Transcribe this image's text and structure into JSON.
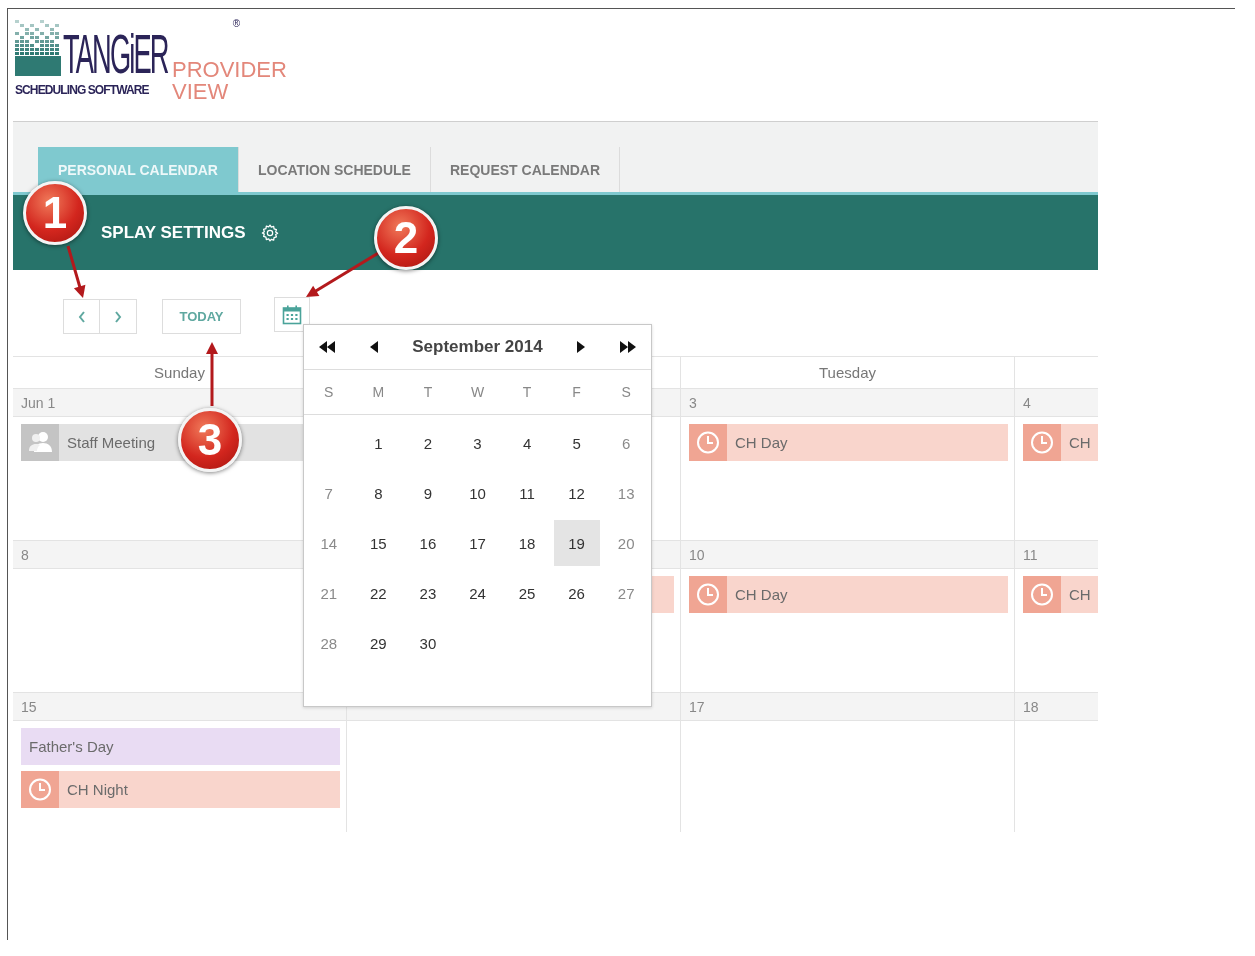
{
  "logo": {
    "brand": "TANGiER",
    "registered": "®",
    "tagline": "SCHEDULING SOFTWARE",
    "product": [
      "PROVIDER",
      "VIEW"
    ]
  },
  "tabs": [
    {
      "label": "PERSONAL CALENDAR",
      "selected": true
    },
    {
      "label": "LOCATION SCHEDULE",
      "selected": false
    },
    {
      "label": "REQUEST CALENDAR",
      "selected": false
    }
  ],
  "settings_bar": {
    "label": "SPLAY SETTINGS"
  },
  "toolbar": {
    "today": "TODAY"
  },
  "calendar": {
    "headers": [
      {
        "kind": "label",
        "label": "Sunday"
      },
      {
        "kind": "blank"
      },
      {
        "kind": "label",
        "label": "Tuesday"
      },
      {
        "kind": "blank"
      }
    ],
    "weeks": [
      {
        "days": [
          {
            "kind": "day",
            "date": "Jun 1",
            "events": [
              {
                "kind": "meeting",
                "title": "Staff Meeting"
              }
            ]
          },
          {
            "kind": "covered"
          },
          {
            "kind": "day",
            "date": "3",
            "events": [
              {
                "kind": "shift",
                "title": "CH Day"
              }
            ]
          },
          {
            "kind": "day",
            "date": "4",
            "events": [
              {
                "kind": "shift",
                "title": "CH"
              }
            ]
          }
        ]
      },
      {
        "days": [
          {
            "kind": "day",
            "date": "8"
          },
          {
            "kind": "covered",
            "events": [
              {
                "kind": "shift"
              }
            ]
          },
          {
            "kind": "day",
            "date": "10",
            "events": [
              {
                "kind": "shift",
                "title": "CH Day"
              }
            ]
          },
          {
            "kind": "day",
            "date": "11",
            "events": [
              {
                "kind": "shift",
                "title": "CH"
              }
            ]
          }
        ]
      },
      {
        "days": [
          {
            "kind": "day",
            "date": "15",
            "events": [
              {
                "kind": "holiday",
                "title": "Father's Day"
              },
              {
                "kind": "shift",
                "title": "CH Night"
              }
            ]
          },
          {
            "kind": "covered"
          },
          {
            "kind": "day",
            "date": "17"
          },
          {
            "kind": "day",
            "date": "18"
          }
        ]
      }
    ]
  },
  "date_picker": {
    "title": "September 2014",
    "weekdays": [
      "S",
      "M",
      "T",
      "W",
      "T",
      "F",
      "S"
    ],
    "rows": [
      {
        "days": [
          {
            "label": "1",
            "weekend": false,
            "selected": false
          },
          {
            "label": "2",
            "weekend": false,
            "selected": false
          },
          {
            "label": "3",
            "weekend": false,
            "selected": false
          },
          {
            "label": "4",
            "weekend": false,
            "selected": false
          },
          {
            "label": "5",
            "weekend": false,
            "selected": false
          },
          {
            "label": "6",
            "weekend": true,
            "selected": false
          }
        ]
      },
      {
        "days": [
          {
            "label": "7",
            "weekend": true,
            "selected": false
          },
          {
            "label": "8",
            "weekend": false,
            "selected": false
          },
          {
            "label": "9",
            "weekend": false,
            "selected": false
          },
          {
            "label": "10",
            "weekend": false,
            "selected": false
          },
          {
            "label": "11",
            "weekend": false,
            "selected": false
          },
          {
            "label": "12",
            "weekend": false,
            "selected": false
          },
          {
            "label": "13",
            "weekend": true,
            "selected": false
          }
        ]
      },
      {
        "days": [
          {
            "label": "14",
            "weekend": true,
            "selected": false
          },
          {
            "label": "15",
            "weekend": false,
            "selected": false
          },
          {
            "label": "16",
            "weekend": false,
            "selected": false
          },
          {
            "label": "17",
            "weekend": false,
            "selected": false
          },
          {
            "label": "18",
            "weekend": false,
            "selected": false
          },
          {
            "label": "19",
            "weekend": false,
            "selected": true
          },
          {
            "label": "20",
            "weekend": true,
            "selected": false
          }
        ]
      },
      {
        "days": [
          {
            "label": "21",
            "weekend": true,
            "selected": false
          },
          {
            "label": "22",
            "weekend": false,
            "selected": false
          },
          {
            "label": "23",
            "weekend": false,
            "selected": false
          },
          {
            "label": "24",
            "weekend": false,
            "selected": false
          },
          {
            "label": "25",
            "weekend": false,
            "selected": false
          },
          {
            "label": "26",
            "weekend": false,
            "selected": false
          },
          {
            "label": "27",
            "weekend": true,
            "selected": false
          }
        ]
      },
      {
        "days": [
          {
            "label": "28",
            "weekend": true,
            "selected": false
          },
          {
            "label": "29",
            "weekend": false,
            "selected": false
          },
          {
            "label": "30",
            "weekend": false,
            "selected": false
          }
        ]
      }
    ]
  },
  "callouts": [
    {
      "label": "1"
    },
    {
      "label": "2"
    },
    {
      "label": "3"
    }
  ]
}
